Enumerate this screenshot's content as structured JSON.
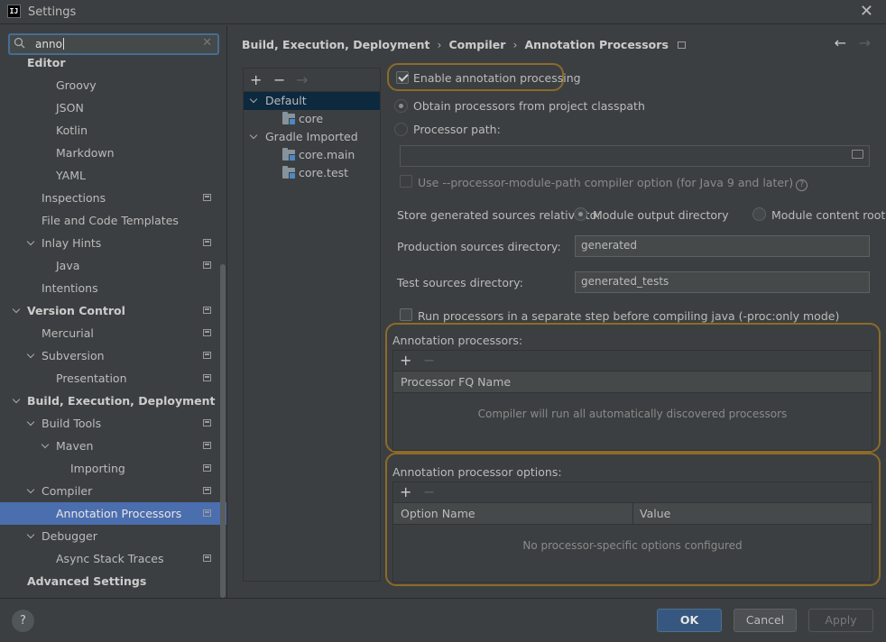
{
  "window": {
    "title": "Settings",
    "app_icon_text": "IJ"
  },
  "search": {
    "value": "anno"
  },
  "sidebar": {
    "items": [
      {
        "label": "Editor",
        "level": 0,
        "bold": true,
        "expanded": null,
        "page": false
      },
      {
        "label": "Groovy",
        "level": 2,
        "page": false
      },
      {
        "label": "JSON",
        "level": 2,
        "page": false
      },
      {
        "label": "Kotlin",
        "level": 2,
        "page": false
      },
      {
        "label": "Markdown",
        "level": 2,
        "page": false
      },
      {
        "label": "YAML",
        "level": 2,
        "page": false
      },
      {
        "label": "Inspections",
        "level": 1,
        "page": true
      },
      {
        "label": "File and Code Templates",
        "level": 1,
        "page": false
      },
      {
        "label": "Inlay Hints",
        "level": 1,
        "expanded": true,
        "page": true
      },
      {
        "label": "Java",
        "level": 2,
        "page": true
      },
      {
        "label": "Intentions",
        "level": 1,
        "page": false
      },
      {
        "label": "Version Control",
        "level": 0,
        "bold": true,
        "expanded": true,
        "page": true
      },
      {
        "label": "Mercurial",
        "level": 1,
        "page": true
      },
      {
        "label": "Subversion",
        "level": 1,
        "expanded": true,
        "page": true
      },
      {
        "label": "Presentation",
        "level": 2,
        "page": true
      },
      {
        "label": "Build, Execution, Deployment",
        "level": 0,
        "bold": true,
        "expanded": true,
        "page": false
      },
      {
        "label": "Build Tools",
        "level": 1,
        "expanded": true,
        "page": true
      },
      {
        "label": "Maven",
        "level": 2,
        "expanded": true,
        "page": true
      },
      {
        "label": "Importing",
        "level": 3,
        "page": true
      },
      {
        "label": "Compiler",
        "level": 1,
        "expanded": true,
        "page": true
      },
      {
        "label": "Annotation Processors",
        "level": 2,
        "page": true,
        "selected": true
      },
      {
        "label": "Debugger",
        "level": 1,
        "expanded": true,
        "page": false
      },
      {
        "label": "Async Stack Traces",
        "level": 2,
        "page": true
      },
      {
        "label": "Advanced Settings",
        "level": 0,
        "bold": true,
        "page": false
      }
    ]
  },
  "breadcrumb": {
    "items": [
      "Build, Execution, Deployment",
      "Compiler",
      "Annotation Processors"
    ],
    "separator": "›"
  },
  "nav": {
    "back": "←",
    "forward": "→"
  },
  "profiles": {
    "toolbar": {
      "add": "+",
      "remove": "−",
      "move": "→"
    },
    "rows": [
      {
        "label": "Default",
        "kind": "group",
        "expanded": true,
        "selected": true
      },
      {
        "label": "core",
        "kind": "module"
      },
      {
        "label": "Gradle Imported",
        "kind": "group",
        "expanded": true
      },
      {
        "label": "core.main",
        "kind": "module"
      },
      {
        "label": "core.test",
        "kind": "module"
      }
    ]
  },
  "options": {
    "enable_annotation_processing": {
      "label": "Enable annotation processing",
      "checked": true
    },
    "obtain_from_classpath": {
      "label": "Obtain processors from project classpath",
      "selected": true
    },
    "processor_path": {
      "label": "Processor path:",
      "selected": false,
      "value": ""
    },
    "module_path_option": {
      "label": "Use --processor-module-path compiler option (for Java 9 and later)",
      "checked": false
    },
    "store_generated": {
      "label": "Store generated sources relative to:",
      "module_output": {
        "label": "Module output directory",
        "selected": true
      },
      "module_content": {
        "label": "Module content root",
        "selected": false
      }
    },
    "production_dir": {
      "label": "Production sources directory:",
      "value": "generated"
    },
    "test_dir": {
      "label": "Test sources directory:",
      "value": "generated_tests"
    },
    "separate_step": {
      "label": "Run processors in a separate step before compiling java (-proc:only mode)",
      "checked": false
    }
  },
  "annotation_processors": {
    "title": "Annotation processors:",
    "toolbar": {
      "add": "+",
      "remove": "−"
    },
    "columns": [
      "Processor FQ Name"
    ],
    "empty_text": "Compiler will run all automatically discovered processors"
  },
  "processor_options": {
    "title": "Annotation processor options:",
    "toolbar": {
      "add": "+",
      "remove": "−"
    },
    "columns": [
      "Option Name",
      "Value"
    ],
    "empty_text": "No processor-specific options configured"
  },
  "buttons": {
    "help": "?",
    "ok": "OK",
    "cancel": "Cancel",
    "apply": "Apply"
  },
  "colors": {
    "background": "#3c3f41",
    "selection": "#4b6eaf",
    "highlight": "#8c6b2a",
    "primary_button": "#365880"
  }
}
